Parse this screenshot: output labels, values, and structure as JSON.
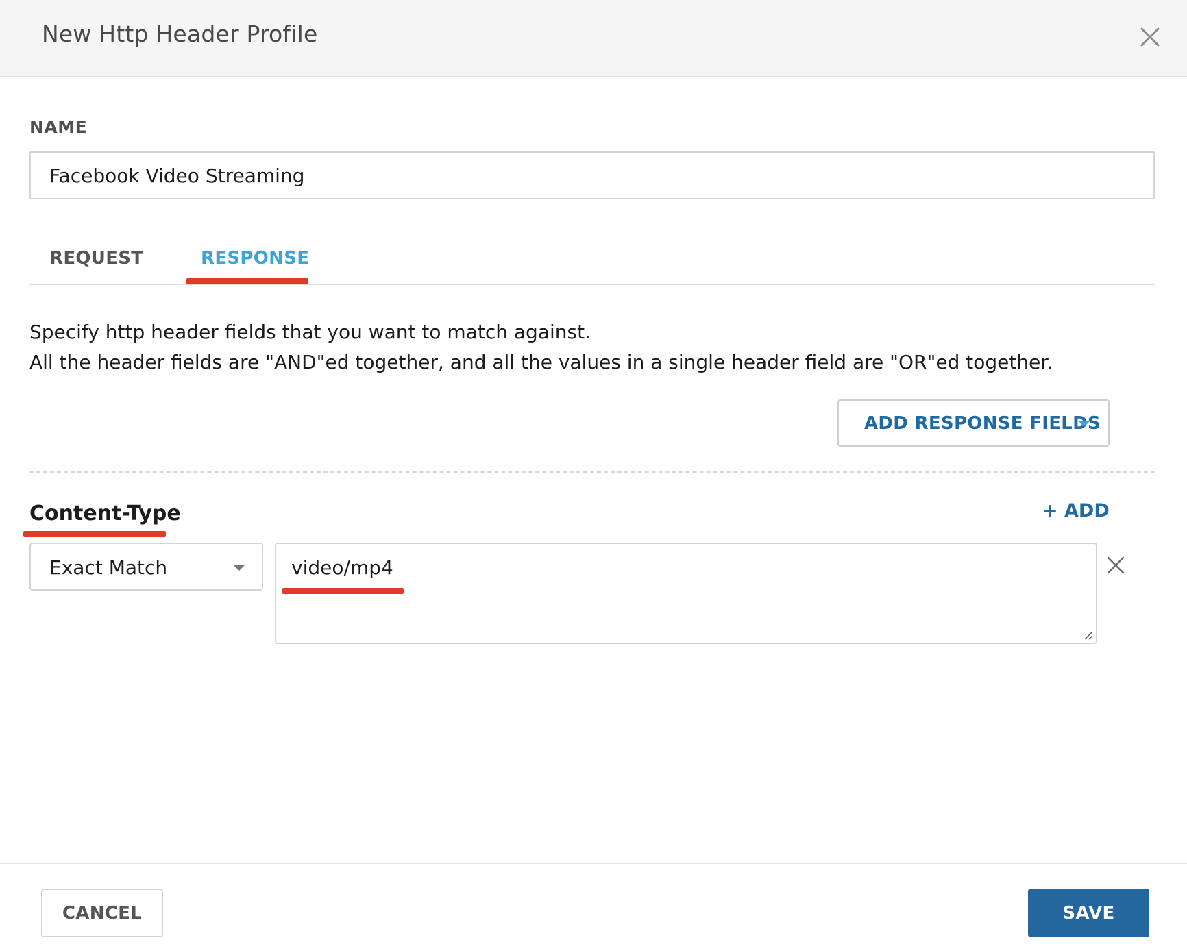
{
  "dialog": {
    "title": "New Http Header Profile"
  },
  "name_field": {
    "label": "NAME",
    "value": "Facebook Video Streaming"
  },
  "tabs": [
    {
      "label": "REQUEST",
      "active": false
    },
    {
      "label": "RESPONSE",
      "active": true
    }
  ],
  "description": {
    "line1": "Specify http header fields that you want to match against.",
    "line2": "All the header fields are \"AND\"ed together, and all the values in a single header field are \"OR\"ed together."
  },
  "add_fields_button": {
    "label": "ADD RESPONSE FIELDS"
  },
  "header_field": {
    "name": "Content-Type",
    "add_label": "+ ADD",
    "match_type": "Exact Match",
    "value": "video/mp4"
  },
  "footer": {
    "cancel_label": "CANCEL",
    "save_label": "SAVE"
  },
  "colors": {
    "accent_blue": "#1f6aa3",
    "active_tab": "#3ea3d6",
    "highlight_red": "#e23a2a",
    "save_bg": "#23679e"
  }
}
